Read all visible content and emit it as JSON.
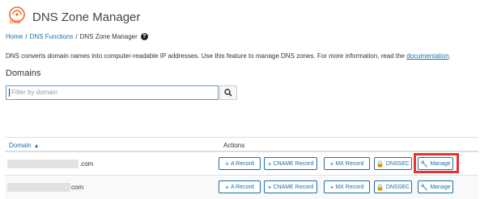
{
  "app": {
    "title": "DNS Zone Manager",
    "logo_text": "DNS",
    "accent_color": "#f06b2b",
    "link_color": "#1d6fa5"
  },
  "breadcrumb": {
    "home": "Home",
    "section": "DNS Functions",
    "current": "DNS Zone Manager",
    "help_icon": "?"
  },
  "description": {
    "text": "DNS converts domain names into computer-readable IP addresses. Use this feature to manage DNS zones. For more information, read the ",
    "link": "documentation",
    "end": "."
  },
  "domains": {
    "heading": "Domains",
    "filter_placeholder": "Filter by domain",
    "search_icon": "search-icon"
  },
  "table": {
    "col_domain": "Domain",
    "col_actions": "Actions",
    "sort_icon": "chevron-up-icon",
    "rows": [
      {
        "domain_suffix": ".com"
      },
      {
        "domain_suffix": "com"
      }
    ],
    "buttons": {
      "a_record": "A Record",
      "cname_record": "CNAME Record",
      "mx_record": "MX Record",
      "dnssec": "DNSSEC",
      "manage": "Manage"
    },
    "highlight_color": "#e3342f"
  }
}
